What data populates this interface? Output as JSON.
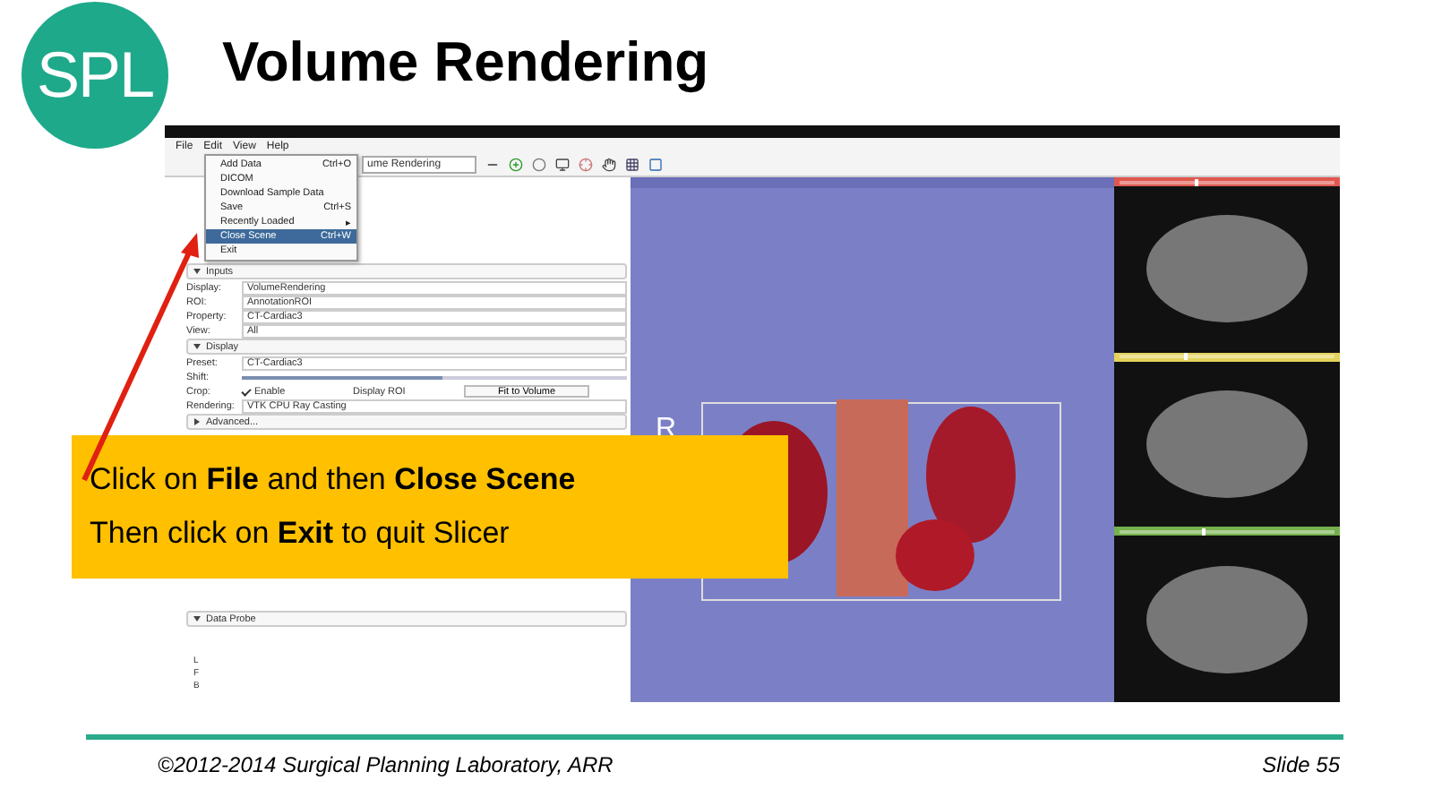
{
  "logo": {
    "text": "SPL"
  },
  "title": "Volume Rendering",
  "screenshot": {
    "menu_bar": [
      "File",
      "Edit",
      "View",
      "Help"
    ],
    "module_selector": "ume Rendering",
    "file_menu": [
      {
        "label": "Add Data",
        "shortcut": "Ctrl+O",
        "selected": false
      },
      {
        "label": "DICOM",
        "selected": false
      },
      {
        "label": "Download Sample Data",
        "selected": false
      },
      {
        "label": "Save",
        "shortcut": "Ctrl+S",
        "selected": false
      },
      {
        "label": "Recently Loaded",
        "shortcut": "▸",
        "selected": false
      },
      {
        "label": "Close Scene",
        "shortcut": "Ctrl+W",
        "selected": true
      },
      {
        "label": "Exit",
        "selected": false
      }
    ],
    "rows": [
      {
        "kind": "section",
        "label": "Inputs",
        "expanded": true
      },
      {
        "kind": "select",
        "label": "Display:",
        "value": "VolumeRendering"
      },
      {
        "kind": "select",
        "label": "ROI:",
        "value": "AnnotationROI"
      },
      {
        "kind": "select",
        "label": "Property:",
        "value": "CT-Cardiac3"
      },
      {
        "kind": "select",
        "label": "View:",
        "value": "All"
      },
      {
        "kind": "section",
        "label": "Display",
        "expanded": true
      },
      {
        "kind": "select",
        "label": "Preset:",
        "value": "CT-Cardiac3"
      },
      {
        "kind": "slider",
        "label": "Shift:",
        "level": 0.52
      },
      {
        "kind": "crop",
        "label": "Crop:",
        "enable": "Enable",
        "checked": true,
        "display_roi": "Display ROI",
        "button": "Fit to Volume"
      },
      {
        "kind": "select",
        "label": "Rendering:",
        "value": "VTK CPU Ray Casting"
      },
      {
        "kind": "section",
        "label": "Advanced...",
        "expanded": false
      }
    ],
    "data_probe": {
      "label": "Data Probe",
      "expanded": true,
      "lines": [
        "L",
        "F",
        "B"
      ]
    },
    "view_3d": {
      "orientation": "R"
    },
    "slices": [
      {
        "color": "#e0574f",
        "level": 0.35
      },
      {
        "color": "#e3d35a",
        "level": 0.3
      },
      {
        "color": "#74b04c",
        "level": 0.38
      }
    ]
  },
  "callout": {
    "lines": [
      "Click on **File** and then **Close Scene**",
      "Then click on **Exit** to quit Slicer"
    ]
  },
  "footer": {
    "copyright": "©2012-2014 Surgical Planning Laboratory, ARR",
    "slide": "Slide 55"
  }
}
